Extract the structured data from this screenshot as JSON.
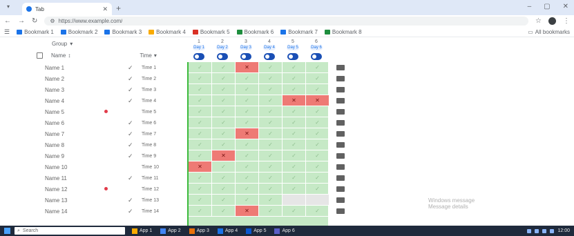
{
  "browser": {
    "tab_title": "Tab",
    "url": "https://www.example.com/",
    "bookmarks": [
      {
        "label": "Bookmark 1",
        "color": "#1a73e8"
      },
      {
        "label": "Bookmark 2",
        "color": "#1a73e8"
      },
      {
        "label": "Bookmark 3",
        "color": "#1a73e8"
      },
      {
        "label": "Bookmark 4",
        "color": "#f9ab00"
      },
      {
        "label": "Bookmark 5",
        "color": "#d93025"
      },
      {
        "label": "Bookmark 6",
        "color": "#1e8e3e"
      },
      {
        "label": "Bookmark 7",
        "color": "#1a73e8"
      },
      {
        "label": "Bookmark 8",
        "color": "#1e8e3e"
      }
    ],
    "all_bookmarks": "All bookmarks"
  },
  "table": {
    "group_label": "Group",
    "name_header": "Name",
    "sort_header": "Time",
    "columns": [
      {
        "num": "1",
        "day": "Day 1"
      },
      {
        "num": "2",
        "day": "Day 2"
      },
      {
        "num": "3",
        "day": "Day 3"
      },
      {
        "num": "4",
        "day": "Day 4"
      },
      {
        "num": "5",
        "day": "Day 5"
      },
      {
        "num": "6",
        "day": "Day 6"
      }
    ],
    "rows": [
      {
        "name": "Name 1",
        "dot": false,
        "check": "✓",
        "time": "Time 1",
        "cells": [
          "ok",
          "ok",
          "x",
          "ok",
          "ok",
          "ok"
        ]
      },
      {
        "name": "Name 2",
        "dot": false,
        "check": "✓",
        "time": "Time 2",
        "cells": [
          "ok",
          "ok",
          "ok",
          "ok",
          "ok",
          "ok"
        ]
      },
      {
        "name": "Name 3",
        "dot": false,
        "check": "✓",
        "time": "Time 3",
        "cells": [
          "ok",
          "ok",
          "ok",
          "ok",
          "ok",
          "ok"
        ]
      },
      {
        "name": "Name 4",
        "dot": false,
        "check": "✓",
        "time": "Time 4",
        "cells": [
          "ok",
          "ok",
          "ok",
          "ok",
          "x",
          "x"
        ]
      },
      {
        "name": "Name 5",
        "dot": true,
        "check": "",
        "time": "Time 5",
        "cells": [
          "ok",
          "ok",
          "ok",
          "ok",
          "ok",
          "ok"
        ]
      },
      {
        "name": "Name 6",
        "dot": false,
        "check": "✓",
        "time": "Time 6",
        "cells": [
          "ok",
          "ok",
          "ok",
          "ok",
          "ok",
          "ok"
        ]
      },
      {
        "name": "Name 7",
        "dot": false,
        "check": "✓",
        "time": "Time 7",
        "cells": [
          "ok",
          "ok",
          "x",
          "ok",
          "ok",
          "ok"
        ]
      },
      {
        "name": "Name 8",
        "dot": false,
        "check": "✓",
        "time": "Time 8",
        "cells": [
          "ok",
          "ok",
          "ok",
          "ok",
          "ok",
          "ok"
        ]
      },
      {
        "name": "Name 9",
        "dot": false,
        "check": "✓",
        "time": "Time 9",
        "cells": [
          "ok",
          "x",
          "ok",
          "ok",
          "ok",
          "ok"
        ]
      },
      {
        "name": "Name 10",
        "dot": false,
        "check": "",
        "time": "Time 10",
        "cells": [
          "x",
          "ok",
          "ok",
          "ok",
          "ok",
          "ok"
        ]
      },
      {
        "name": "Name 11",
        "dot": false,
        "check": "✓",
        "time": "Time 11",
        "cells": [
          "ok",
          "ok",
          "ok",
          "ok",
          "ok",
          "ok"
        ]
      },
      {
        "name": "Name 12",
        "dot": true,
        "check": "",
        "time": "Time 12",
        "cells": [
          "ok",
          "ok",
          "ok",
          "ok",
          "ok",
          "ok"
        ]
      },
      {
        "name": "Name 13",
        "dot": false,
        "check": "✓",
        "time": "Time 13",
        "cells": [
          "ok",
          "ok",
          "ok",
          "ok",
          "grey",
          "grey"
        ]
      },
      {
        "name": "Name 14",
        "dot": false,
        "check": "✓",
        "time": "Time 14",
        "cells": [
          "ok",
          "ok",
          "x",
          "ok",
          "ok",
          "ok"
        ]
      }
    ],
    "ok_glyph": "✓",
    "x_glyph": "✕"
  },
  "watermark": {
    "line1": "Windows message",
    "line2": "Message details"
  },
  "taskbar": {
    "search_placeholder": "Search",
    "apps": [
      {
        "label": "App 1",
        "color": "#f9ab00"
      },
      {
        "label": "App 2",
        "color": "#4285f4"
      },
      {
        "label": "App 3",
        "color": "#e8710a"
      },
      {
        "label": "App 4",
        "color": "#1a73e8"
      },
      {
        "label": "App 5",
        "color": "#0b57d0"
      },
      {
        "label": "App 6",
        "color": "#5b5fc7"
      }
    ],
    "time": "12:00"
  },
  "colors": {
    "accent": "#1a4fb5",
    "grid_green": "#c6e9c6",
    "red_cell": "#ee7a75"
  }
}
